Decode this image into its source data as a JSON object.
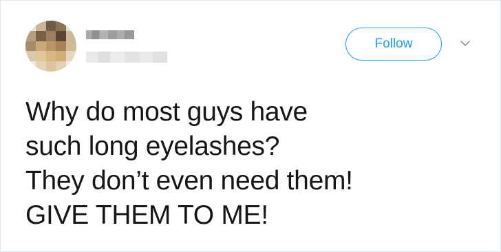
{
  "tweet": {
    "follow_label": "Follow",
    "text_lines": [
      "Why do most guys have",
      "such long eyelashes?",
      "They don’t even need them!",
      "GIVE THEM TO ME!"
    ]
  },
  "icons": {
    "more": "chevron-down-icon"
  },
  "colors": {
    "accent": "#1da1f2",
    "text": "#14171a",
    "border": "#e1e8ed"
  }
}
